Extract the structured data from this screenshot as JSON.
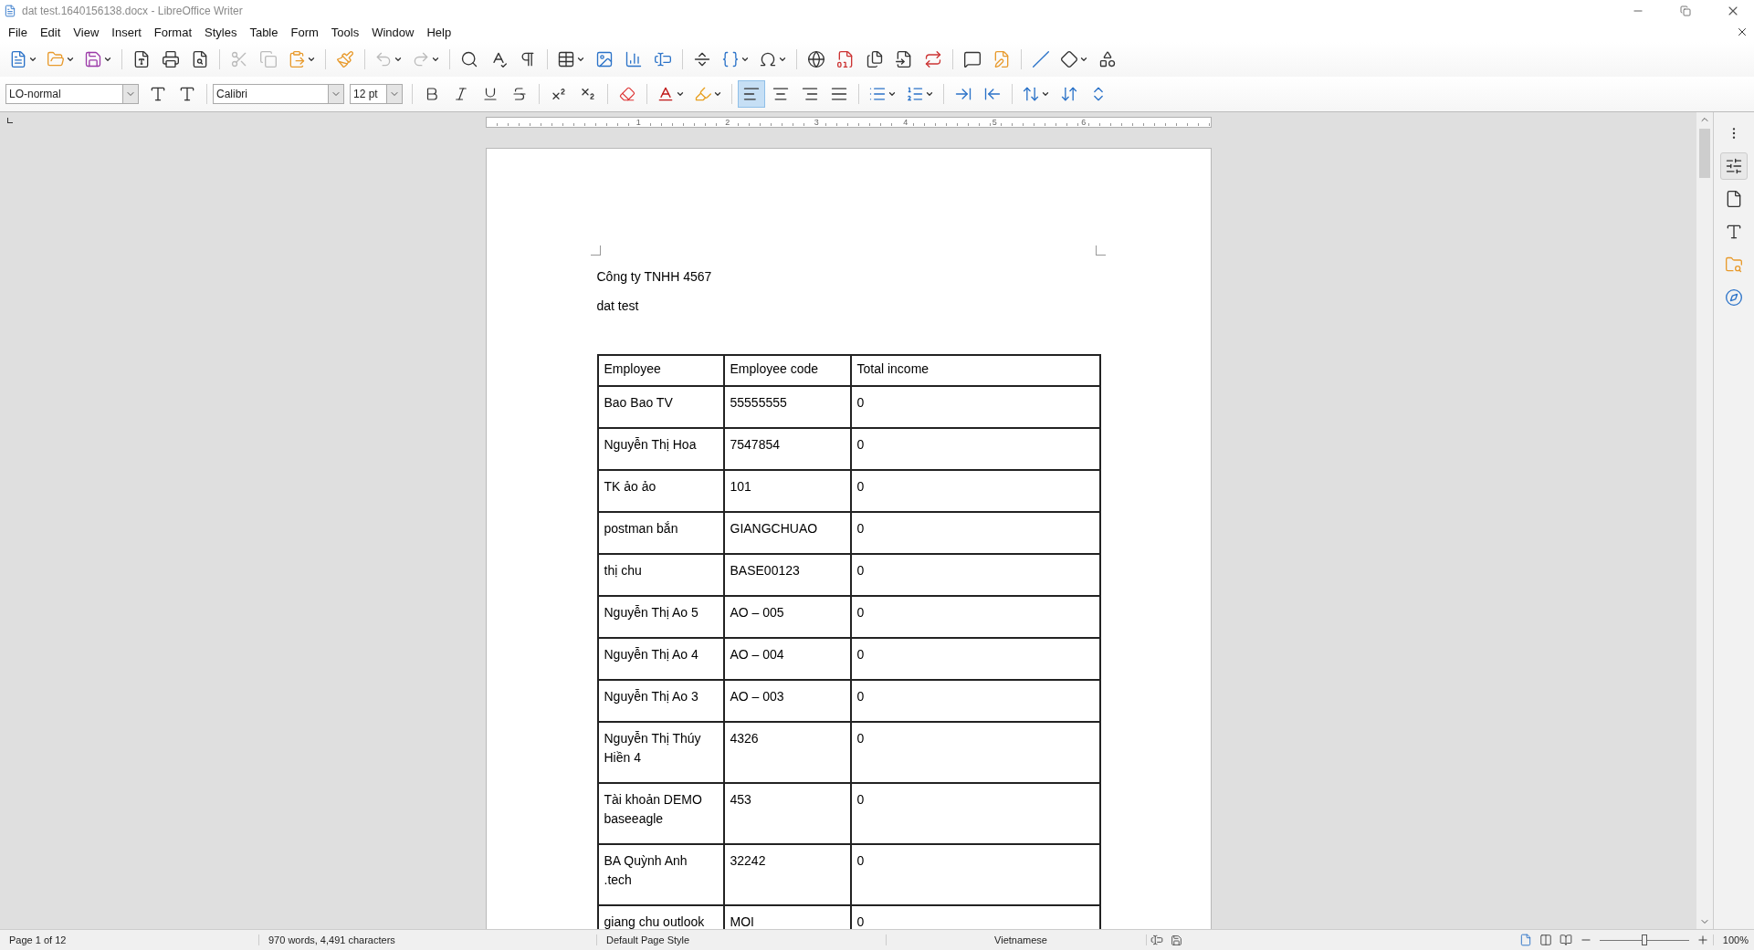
{
  "window": {
    "title": "dat test.1640156138.docx - LibreOffice Writer"
  },
  "menu": [
    "File",
    "Edit",
    "View",
    "Insert",
    "Format",
    "Styles",
    "Table",
    "Form",
    "Tools",
    "Window",
    "Help"
  ],
  "formatting": {
    "paragraph_style": "LO-normal",
    "font": "Calibri",
    "size": "12 pt",
    "alignment": [
      {
        "kind": "left",
        "selected": true
      },
      {
        "kind": "center",
        "selected": false
      },
      {
        "kind": "right",
        "selected": false
      },
      {
        "kind": "justify",
        "selected": false
      }
    ]
  },
  "ruler": {
    "labels": [
      "1",
      "2",
      "3",
      "4",
      "5",
      "6"
    ]
  },
  "document": {
    "paragraphs": [
      "Công ty TNHH 4567",
      "dat test"
    ],
    "table": {
      "columns": [
        "Employee",
        "Employee code",
        "Total income"
      ],
      "rows": [
        {
          "cells": [
            "Bao Bao TV",
            "55555555",
            "0"
          ]
        },
        {
          "cells": [
            "Nguyễn Thị Hoa",
            "7547854",
            "0"
          ]
        },
        {
          "cells": [
            "TK ảo ảo",
            "101",
            "0"
          ]
        },
        {
          "cells": [
            "postman bắn",
            "GIANGCHUAO",
            "0"
          ]
        },
        {
          "cells": [
            "thị chu",
            "BASE00123",
            "0"
          ]
        },
        {
          "cells": [
            "Nguyễn Thị Ao 5",
            "AO – 005",
            "0"
          ]
        },
        {
          "cells": [
            "Nguyễn Thị Ao 4",
            "AO – 004",
            "0"
          ]
        },
        {
          "cells": [
            "Nguyễn Thị Ao 3",
            "AO – 003",
            "0"
          ]
        },
        {
          "cells": [
            "Nguyễn Thị Thúy Hiền 4",
            "4326",
            "0"
          ]
        },
        {
          "cells": [
            "Tài khoản DEMO baseeagle",
            "453",
            "0"
          ]
        },
        {
          "cells": [
            "BA Quỳnh Anh .tech",
            "32242",
            "0"
          ]
        },
        {
          "cells": [
            "giang chu outlook",
            "MOI",
            "0"
          ]
        }
      ]
    }
  },
  "status_bar": {
    "page": "Page 1 of 12",
    "counts": "970 words, 4,491 characters",
    "page_style": "Default Page Style",
    "language": "Vietnamese",
    "zoom": {
      "level": 0.5,
      "reading": "100%"
    }
  }
}
